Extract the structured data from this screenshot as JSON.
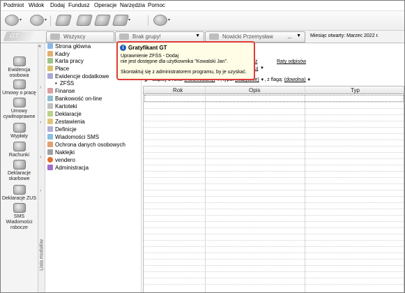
{
  "menu": [
    "Podmiot",
    "Widok",
    "Dodaj",
    "Fundusz",
    "Operacje",
    "Narzędzia",
    "Pomoc"
  ],
  "logo": "GT",
  "filters": {
    "tab1": "Wszyscy",
    "tab2": "Brak grupy!",
    "tab3": "Nowicki Przemysław",
    "tab3_suffix": "...",
    "month": "Miesiąc otwarty: Marzec 2022 r."
  },
  "sidebar": [
    {
      "label": "Ewidencja osobowa",
      "icon": "people-icon"
    },
    {
      "label": "Umowy o pracę",
      "icon": "contract-icon"
    },
    {
      "label": "Umowy cywilnoprawne",
      "icon": "civil-contract-icon"
    },
    {
      "label": "Wypłaty",
      "icon": "payout-icon"
    },
    {
      "label": "Rachunki",
      "icon": "bill-icon"
    },
    {
      "label": "Deklaracje skarbowe",
      "icon": "tax-declaration-icon"
    },
    {
      "label": "Deklaracje ZUS",
      "icon": "zus-icon"
    },
    {
      "label": "SMS Wiadomości robocze",
      "icon": "sms-icon"
    }
  ],
  "side_strip_label": "Lista modułów",
  "tree": [
    "Strona główna",
    "Kadry",
    "Karta pracy",
    "Płace",
    "Ewidencje dodatkowe",
    "ZFŚS",
    "Finanse",
    "Bankowość on-line",
    "Kartoteki",
    "Deklaracje",
    "Zestawienia",
    "Definicje",
    "Wiadomości SMS",
    "Ochrona danych osobowych",
    "Naklejki",
    "vendero",
    "Administracja"
  ],
  "main": {
    "links": {
      "pokaz": "Pokaż",
      "raty": "Raty odpisów",
      "drukuj": "Drukuj"
    },
    "filter_line": {
      "prefix": "Zapisy z roku:",
      "year": "(nieokreślony)",
      "typ_label": ", typu:",
      "typ": "(wszystkie)",
      "flaga_label": ", z flagą:",
      "flaga": "(dowolna)"
    },
    "columns": [
      "Rok",
      "Opis",
      "Typ"
    ]
  },
  "popup": {
    "title": "Gratyfikant GT",
    "line1": "Uprawnienie ZFŚS - Dodaj",
    "line2": "nie jest dostępne dla użytkownika \"Kowalski Jan\".",
    "line3": "Skontaktuj się z administratorem programu, by je uzyskać."
  },
  "colors": {
    "popup_border": "#e03a3a",
    "popup_bg": "#fffde6",
    "info_icon": "#1f5fbf"
  }
}
